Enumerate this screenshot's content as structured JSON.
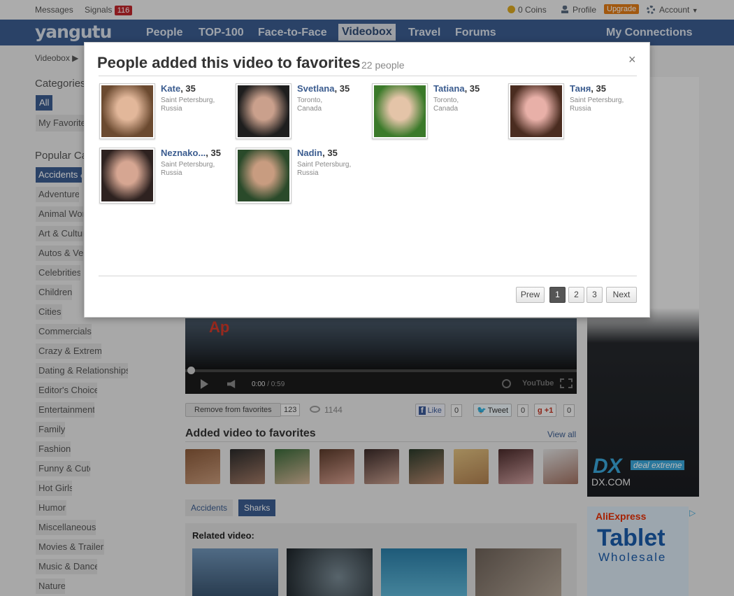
{
  "topbar": {
    "messages": "Messages",
    "signals": "Signals",
    "signals_count": "116",
    "coins": "0 Coins",
    "profile": "Profile",
    "upgrade": "Upgrade",
    "account": "Account"
  },
  "nav": {
    "logo": "yangutu",
    "items": [
      "People",
      "TOP-100",
      "Face-to-Face",
      "Videobox",
      "Travel",
      "Forums"
    ],
    "connections": "My Connections"
  },
  "breadcrumb": "Videobox",
  "sidebar": {
    "categories_title": "Categories",
    "all": "All",
    "my_favorites": "My Favorites",
    "popular_title": "Popular Categories",
    "items": [
      "Accidents & Disasters",
      "Adventures",
      "Animal World",
      "Art & Culture",
      "Autos & Vehicles",
      "Celebrities",
      "Children",
      "Cities",
      "Commercials",
      "Crazy & Extreme",
      "Dating & Relationships",
      "Editor's Choice",
      "Entertainment",
      "Family",
      "Fashion",
      "Funny & Cute",
      "Hot Girls",
      "Humor",
      "Miscellaneous",
      "Movies & Trailers",
      "Music & Dance",
      "Nature"
    ]
  },
  "player": {
    "time": "0:00",
    "duration": "/ 0:59",
    "brand": "YouTube"
  },
  "actions": {
    "remove_favorites": "Remove from favorites",
    "fav_count": "123",
    "views": "1144",
    "like": "Like",
    "like_count": "0",
    "tweet": "Tweet",
    "tweet_count": "0",
    "gplus": "+1",
    "gplus_count": "0"
  },
  "favorites_section": {
    "title": "Added video to favorites",
    "view_all": "View all"
  },
  "tags": [
    "Accidents",
    "Sharks"
  ],
  "related": {
    "title": "Related video:"
  },
  "ads": {
    "dx_text": "deal extreme",
    "dx_url": "DX.COM",
    "ali": "AliExpress",
    "tablet": "Tablet",
    "wholesale": "Wholesale"
  },
  "modal": {
    "title": "People added this video to favorites",
    "count": "22 people",
    "close": "×",
    "people": [
      {
        "name": "Kate",
        "age": ", 35",
        "city": "Saint Petersburg,",
        "country": "Russia"
      },
      {
        "name": "Svetlana",
        "age": ", 35",
        "city": "Toronto,",
        "country": "Canada"
      },
      {
        "name": "Tatiana",
        "age": ", 35",
        "city": "Toronto,",
        "country": "Canada"
      },
      {
        "name": "Таня",
        "age": ", 35",
        "city": "Saint Petersburg,",
        "country": "Russia"
      },
      {
        "name": "Neznako...",
        "age": ", 35",
        "city": "Saint Petersburg,",
        "country": "Russia"
      },
      {
        "name": "Nadin",
        "age": ", 35",
        "city": "Saint Petersburg,",
        "country": "Russia"
      }
    ],
    "pagination": {
      "prev": "Prew",
      "pages": [
        "1",
        "2",
        "3"
      ],
      "next": "Next"
    }
  }
}
